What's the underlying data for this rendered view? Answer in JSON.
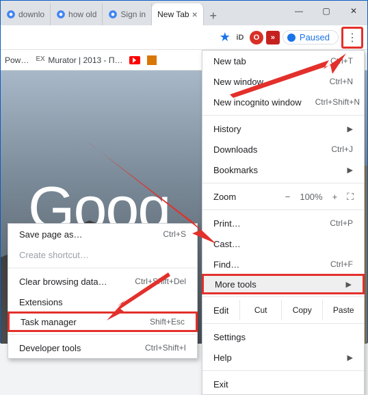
{
  "window": {
    "title": "New Tab"
  },
  "tabs": [
    {
      "label": "downlo",
      "favicon": "google"
    },
    {
      "label": "how old",
      "favicon": "google"
    },
    {
      "label": "Sign in",
      "favicon": "google"
    },
    {
      "label": "New Tab",
      "active": true
    }
  ],
  "toolbar": {
    "paused_label": "Paused",
    "extensions": [
      "iD",
      "O",
      "»"
    ]
  },
  "bookmarks": [
    {
      "label": "Pow…"
    },
    {
      "label": "Murator | 2013 - П…",
      "prefix": "EX"
    }
  ],
  "page": {
    "logo_text": "Goog"
  },
  "main_menu": {
    "new_tab": {
      "label": "New tab",
      "shortcut": "Ctrl+T"
    },
    "new_window": {
      "label": "New window",
      "shortcut": "Ctrl+N"
    },
    "new_incognito": {
      "label": "New incognito window",
      "shortcut": "Ctrl+Shift+N"
    },
    "history": {
      "label": "History"
    },
    "downloads": {
      "label": "Downloads",
      "shortcut": "Ctrl+J"
    },
    "bookmarks": {
      "label": "Bookmarks"
    },
    "zoom": {
      "label": "Zoom",
      "minus": "−",
      "value": "100%",
      "plus": "+"
    },
    "print": {
      "label": "Print…",
      "shortcut": "Ctrl+P"
    },
    "cast": {
      "label": "Cast…"
    },
    "find": {
      "label": "Find…",
      "shortcut": "Ctrl+F"
    },
    "more_tools": {
      "label": "More tools"
    },
    "edit": {
      "label": "Edit",
      "cut": "Cut",
      "copy": "Copy",
      "paste": "Paste"
    },
    "settings": {
      "label": "Settings"
    },
    "help": {
      "label": "Help"
    },
    "exit": {
      "label": "Exit"
    }
  },
  "sub_menu": {
    "save_page": {
      "label": "Save page as…",
      "shortcut": "Ctrl+S"
    },
    "create_shortcut": {
      "label": "Create shortcut…"
    },
    "clear_data": {
      "label": "Clear browsing data…",
      "shortcut": "Ctrl+Shift+Del"
    },
    "extensions": {
      "label": "Extensions"
    },
    "task_manager": {
      "label": "Task manager",
      "shortcut": "Shift+Esc"
    },
    "dev_tools": {
      "label": "Developer tools",
      "shortcut": "Ctrl+Shift+I"
    }
  },
  "colors": {
    "highlight": "#e3302b",
    "link": "#1a73e8"
  }
}
